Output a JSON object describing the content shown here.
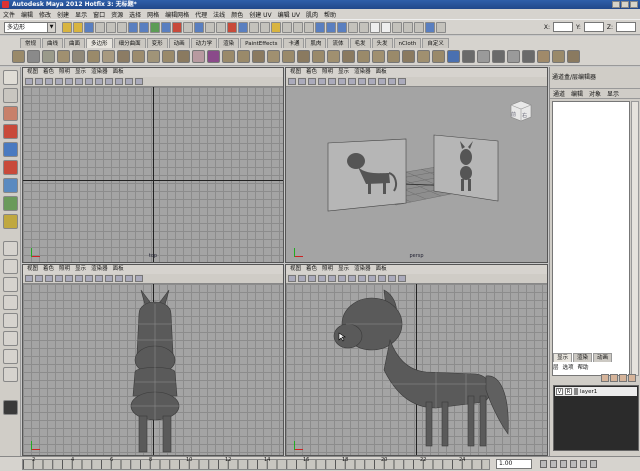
{
  "window": {
    "title": "Autodesk Maya 2012 Hotfix 3: 无标题*"
  },
  "menubar": {
    "items": [
      "文件",
      "编辑",
      "修改",
      "创建",
      "显示",
      "窗口",
      "资源",
      "选择",
      "网格",
      "编辑网格",
      "代理",
      "法线",
      "颜色",
      "创建 UV",
      "编辑 UV",
      "肌肉",
      "帮助"
    ]
  },
  "statusline": {
    "mode": "多边形",
    "xyz_labels": [
      "X:",
      "Y:",
      "Z:"
    ]
  },
  "shelf": {
    "tabs": [
      "常规",
      "曲线",
      "曲面",
      "多边形",
      "细分曲面",
      "变形",
      "动画",
      "动力学",
      "渲染",
      "PaintEffects",
      "卡通",
      "肌肉",
      "流体",
      "毛发",
      "头发",
      "nCloth",
      "自定义"
    ],
    "active_tab": "多边形"
  },
  "viewports": {
    "menu": [
      "视图",
      "着色",
      "照明",
      "显示",
      "渲染器",
      "面板"
    ],
    "top_left_camera": "top",
    "top_right_camera": "persp",
    "viewcube_labels": [
      "前",
      "右"
    ]
  },
  "channel_box": {
    "title": "通道盒/层编辑器",
    "menu": [
      "通道",
      "编辑",
      "对象",
      "显示"
    ]
  },
  "layer_editor": {
    "tabs": [
      "显示",
      "渲染",
      "动画"
    ],
    "menu": [
      "层",
      "选项",
      "帮助"
    ],
    "layer": {
      "v": "V",
      "r": "R",
      "name": "layer1"
    }
  },
  "timeline": {
    "ticks": [
      "2",
      "4",
      "6",
      "8",
      "10",
      "12",
      "14",
      "16",
      "18",
      "20",
      "22",
      "24"
    ],
    "current_time": "1.00"
  },
  "colors": {
    "title_bar": "#2f5faa",
    "viewport_bg": "#a4a4a4",
    "ui_bg": "#d6d3ce"
  }
}
